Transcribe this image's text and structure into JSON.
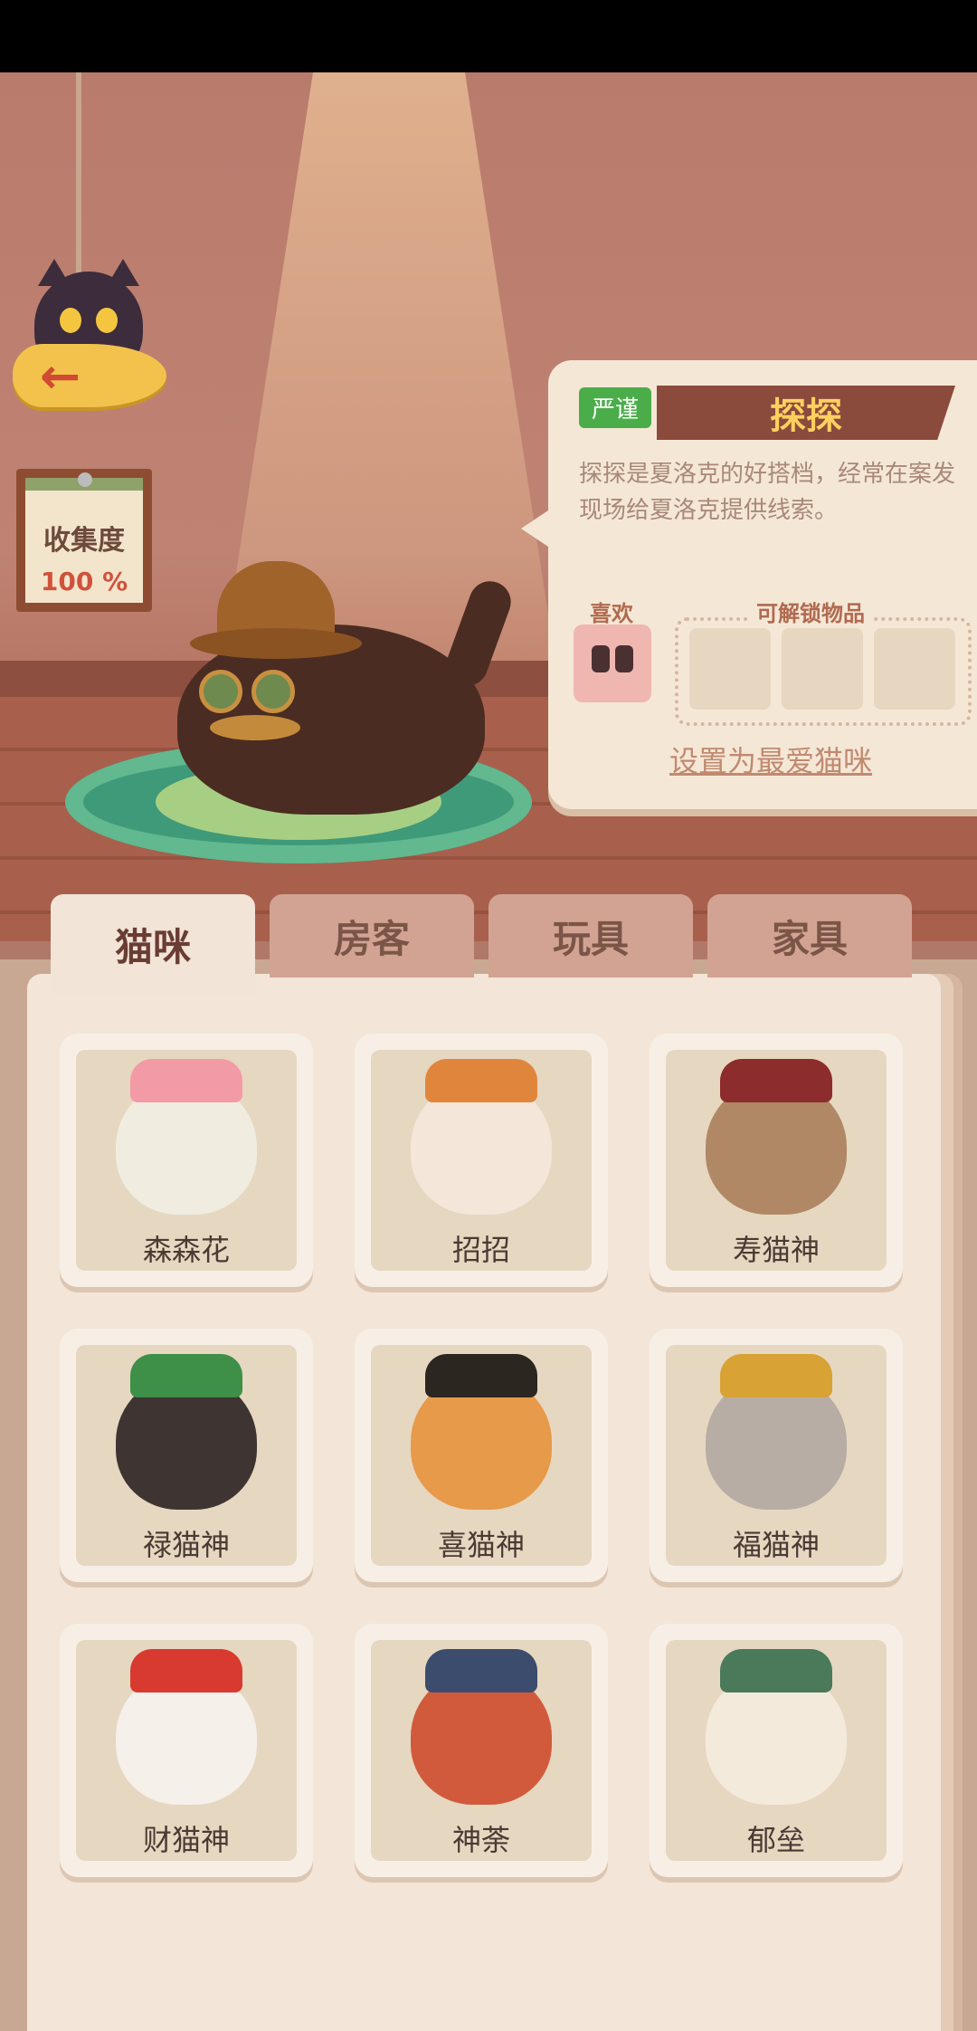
{
  "collection": {
    "title": "收集度",
    "value": "100 %"
  },
  "featured": {
    "trait": "严谨",
    "name": "探探",
    "description": "探探是夏洛克的好搭档，经常在案发现场给夏洛克提供线索。",
    "likes_label": "喜欢",
    "likes_icon": "binoculars-icon",
    "unlockables_label": "可解锁物品",
    "set_favorite": "设置为最爱猫咪"
  },
  "tabs": [
    {
      "label": "猫咪",
      "active": true
    },
    {
      "label": "房客",
      "active": false
    },
    {
      "label": "玩具",
      "active": false
    },
    {
      "label": "家具",
      "active": false
    }
  ],
  "cats": [
    {
      "name": "森森花",
      "body": "#f0ece0",
      "hat": "#f29aa6"
    },
    {
      "name": "招招",
      "body": "#f4e6d8",
      "hat": "#e0863c"
    },
    {
      "name": "寿猫神",
      "body": "#b08866",
      "hat": "#8c2c2c"
    },
    {
      "name": "禄猫神",
      "body": "#3e3532",
      "hat": "#3e8f48"
    },
    {
      "name": "喜猫神",
      "body": "#e69a4a",
      "hat": "#2c2620"
    },
    {
      "name": "福猫神",
      "body": "#b7ada4",
      "hat": "#d8a234"
    },
    {
      "name": "财猫神",
      "body": "#f6f0ea",
      "hat": "#d83a30"
    },
    {
      "name": "神荼",
      "body": "#d25a3c",
      "hat": "#3c4c6c"
    },
    {
      "name": "郁垒",
      "body": "#f4eadc",
      "hat": "#4a7a5a"
    }
  ],
  "colors": {
    "trait_badge": "#4bad4a",
    "banner": "#8a4b3d",
    "banner_text": "#ffd060"
  },
  "icons": {
    "back": "back-arrow-icon",
    "collection": "paw-icon"
  }
}
